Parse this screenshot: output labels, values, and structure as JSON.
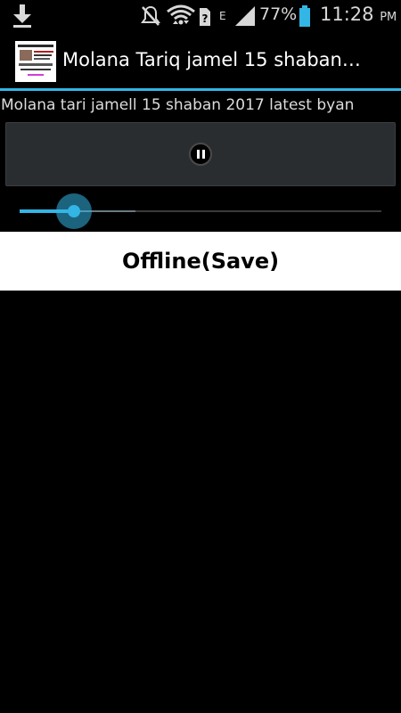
{
  "status_bar": {
    "icons": [
      "download-icon",
      "mute-icon",
      "wifi-icon",
      "sim-unknown-icon",
      "network-e-icon",
      "signal-icon",
      "battery-icon"
    ],
    "network_type": "E",
    "battery_percent": "77%",
    "time": "11:28",
    "ampm": "PM"
  },
  "action_bar": {
    "title": "Molana Tariq jamel 15 shaban…"
  },
  "player": {
    "track_title": "Molana tari jamell 15 shaban 2017  latest byan",
    "state": "playing",
    "progress_fraction": 0.15,
    "buffered_fraction": 0.32
  },
  "offline_button": {
    "label": "Offline(Save)"
  },
  "colors": {
    "accent": "#33b5e5",
    "background": "#000000",
    "panel": "#2a2d30",
    "button_bg": "#ffffff"
  }
}
